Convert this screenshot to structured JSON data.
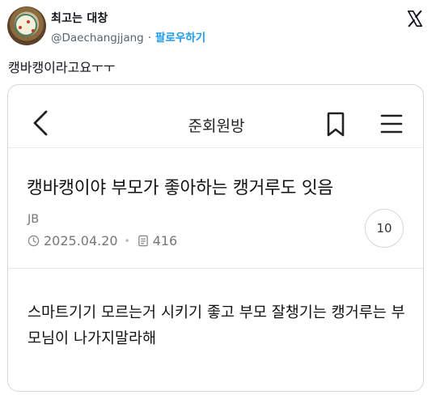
{
  "tweet": {
    "display_name": "최고는 대창",
    "handle": "@Daechangjjang",
    "follow_label": "팔로우하기",
    "text": "캥바캥이라고요ㅜㅜ"
  },
  "screenshot": {
    "nav_title": "준회원방",
    "post_title": "캥바캥이야 부모가 좋아하는 캥거루도 잇음",
    "author": "JB",
    "date": "2025.04.20",
    "views": "416",
    "comment_count": "10",
    "body": "스마트기기 모르는거 시키기 좋고 부모 잘챙기는 캥거루는 부모님이 나가지말라해"
  },
  "colors": {
    "accent": "#1d9bf0",
    "border": "#cfd9de",
    "muted": "#536471"
  },
  "icons": [
    "x-logo-icon",
    "back-arrow-icon",
    "bookmark-icon",
    "menu-icon",
    "clock-icon",
    "document-icon"
  ]
}
